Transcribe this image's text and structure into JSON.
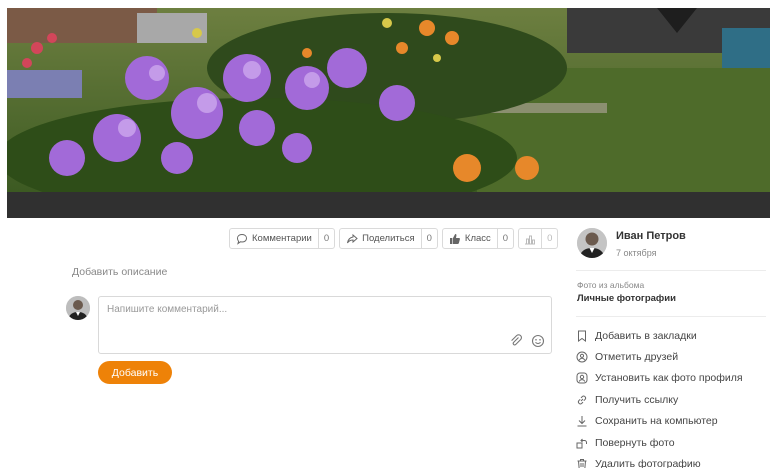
{
  "actions": {
    "comments": {
      "label": "Комментарии",
      "count": "0"
    },
    "share": {
      "label": "Поделиться",
      "count": "0"
    },
    "like": {
      "label": "Класс",
      "count": "0"
    },
    "promote": {
      "count": "0"
    }
  },
  "description_link": "Добавить описание",
  "comment": {
    "placeholder": "Напишите комментарий...",
    "submit_label": "Добавить"
  },
  "author": {
    "name": "Иван Петров",
    "date": "7 октября"
  },
  "album": {
    "caption": "Фото из альбома",
    "name": "Личные фотографии"
  },
  "menu": [
    {
      "label": "Добавить в закладки",
      "icon": "bookmark-icon"
    },
    {
      "label": "Отметить друзей",
      "icon": "tag-friends-icon"
    },
    {
      "label": "Установить как фото профиля",
      "icon": "profile-photo-icon"
    },
    {
      "label": "Получить ссылку",
      "icon": "link-icon"
    },
    {
      "label": "Сохранить на компьютер",
      "icon": "download-icon"
    },
    {
      "label": "Повернуть фото",
      "icon": "rotate-icon"
    },
    {
      "label": "Удалить фотографию",
      "icon": "trash-icon"
    }
  ],
  "colors": {
    "accent": "#ee8208",
    "photo_bar": "#303030"
  }
}
